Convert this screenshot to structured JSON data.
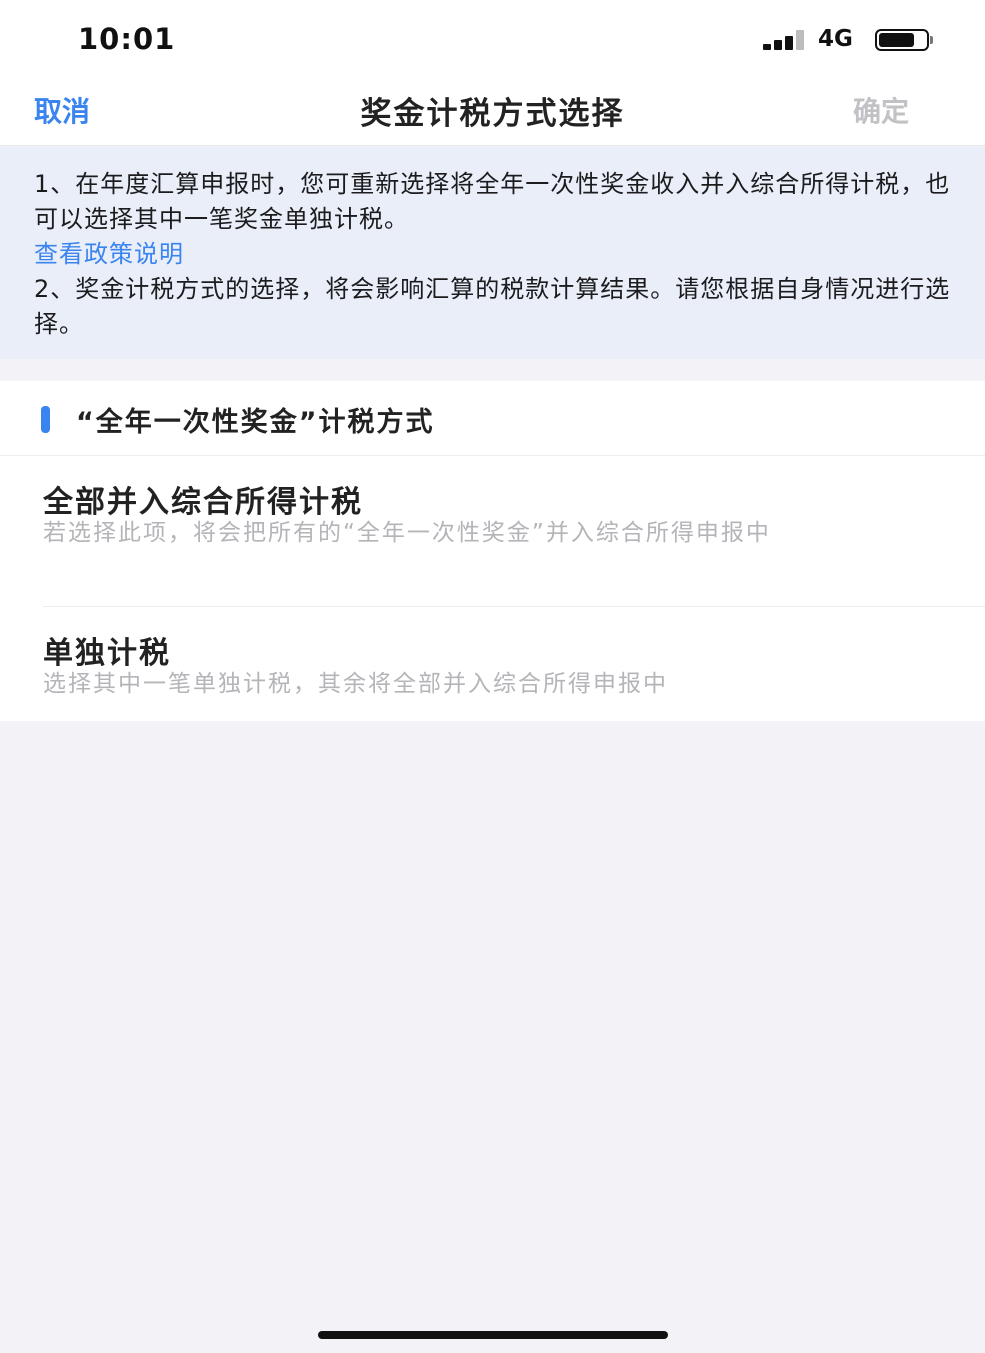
{
  "status_bar": {
    "time": "10:01",
    "network": "4G",
    "signal_icon": "signal-bars-icon",
    "battery_icon": "battery-icon",
    "battery_level": 0.75
  },
  "nav": {
    "cancel_label": "取消",
    "title": "奖金计税方式选择",
    "confirm_label": "确定"
  },
  "notice": {
    "line1": "1、在年度汇算申报时，您可重新选择将全年一次性奖金收入并入综合所得计税，也可以选择其中一笔奖金单独计税。",
    "policy_link": "查看政策说明",
    "line2": "2、奖金计税方式的选择，将会影响汇算的税款计算结果。请您根据自身情况进行选择。"
  },
  "section": {
    "title": "“全年一次性奖金”计税方式",
    "options": [
      {
        "title": "全部并入综合所得计税",
        "description": "若选择此项，将会把所有的“全年一次性奖金”并入综合所得申报中"
      },
      {
        "title": "单独计税",
        "description": "选择其中一笔单独计税，其余将全部并入综合所得申报中"
      }
    ]
  }
}
